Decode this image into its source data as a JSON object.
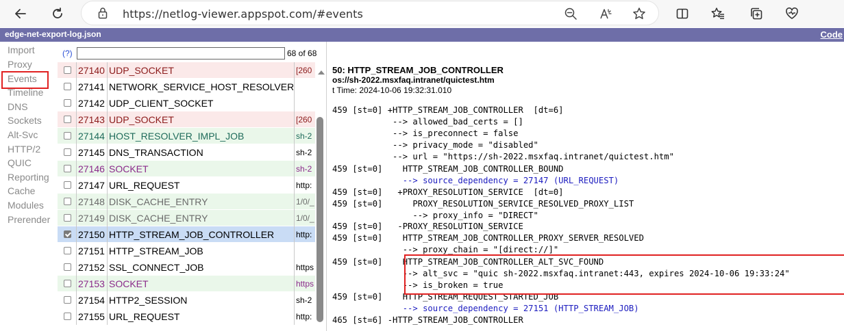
{
  "browser": {
    "url": "https://netlog-viewer.appspot.com/#events"
  },
  "app": {
    "title": "edge-net-export-log.json",
    "code_link": "Code"
  },
  "sidebar": {
    "items": [
      {
        "label": "Import"
      },
      {
        "label": "Proxy"
      },
      {
        "label": "Events"
      },
      {
        "label": "Timeline"
      },
      {
        "label": "DNS"
      },
      {
        "label": "Sockets"
      },
      {
        "label": "Alt-Svc"
      },
      {
        "label": "HTTP/2"
      },
      {
        "label": "QUIC"
      },
      {
        "label": "Reporting"
      },
      {
        "label": "Cache"
      },
      {
        "label": "Modules"
      },
      {
        "label": "Prerender"
      }
    ]
  },
  "events": {
    "help_link": "(?)",
    "filter_value": "",
    "count": "68 of 68",
    "rows": [
      {
        "id": "27140",
        "type": "UDP_SOCKET",
        "desc": "[260",
        "checked": false,
        "bg": "#fbe9e9",
        "color": "#8b1a1a"
      },
      {
        "id": "27141",
        "type": "NETWORK_SERVICE_HOST_RESOLVER",
        "desc": "",
        "checked": false,
        "bg": "#ffffff",
        "color": "#000000"
      },
      {
        "id": "27142",
        "type": "UDP_CLIENT_SOCKET",
        "desc": "",
        "checked": false,
        "bg": "#ffffff",
        "color": "#000000"
      },
      {
        "id": "27143",
        "type": "UDP_SOCKET",
        "desc": "[260",
        "checked": false,
        "bg": "#fbe9e9",
        "color": "#8b1a1a"
      },
      {
        "id": "27144",
        "type": "HOST_RESOLVER_IMPL_JOB",
        "desc": "sh-2",
        "checked": false,
        "bg": "#eaf7ea",
        "color": "#1e6b5a"
      },
      {
        "id": "27145",
        "type": "DNS_TRANSACTION",
        "desc": "sh-2",
        "checked": false,
        "bg": "#ffffff",
        "color": "#000000"
      },
      {
        "id": "27146",
        "type": "SOCKET",
        "desc": "sh-2",
        "checked": false,
        "bg": "#eaf7ea",
        "color": "#8a2a8a"
      },
      {
        "id": "27147",
        "type": "URL_REQUEST",
        "desc": "http:",
        "checked": false,
        "bg": "#ffffff",
        "color": "#000000"
      },
      {
        "id": "27148",
        "type": "DISK_CACHE_ENTRY",
        "desc": "1/0/_",
        "checked": false,
        "bg": "#eaf7ea",
        "color": "#6a6a6a"
      },
      {
        "id": "27149",
        "type": "DISK_CACHE_ENTRY",
        "desc": "1/0/_",
        "checked": false,
        "bg": "#eaf7ea",
        "color": "#6a6a6a"
      },
      {
        "id": "27150",
        "type": "HTTP_STREAM_JOB_CONTROLLER",
        "desc": "http:",
        "checked": true,
        "bg": "#c9dcf5",
        "color": "#000000"
      },
      {
        "id": "27151",
        "type": "HTTP_STREAM_JOB",
        "desc": "",
        "checked": false,
        "bg": "#ffffff",
        "color": "#000000"
      },
      {
        "id": "27152",
        "type": "SSL_CONNECT_JOB",
        "desc": "https",
        "checked": false,
        "bg": "#ffffff",
        "color": "#000000"
      },
      {
        "id": "27153",
        "type": "SOCKET",
        "desc": "https",
        "checked": false,
        "bg": "#eaf7ea",
        "color": "#8a2a8a"
      },
      {
        "id": "27154",
        "type": "HTTP2_SESSION",
        "desc": "sh-2",
        "checked": false,
        "bg": "#ffffff",
        "color": "#000000"
      },
      {
        "id": "27155",
        "type": "URL_REQUEST",
        "desc": "http:",
        "checked": false,
        "bg": "#ffffff",
        "color": "#000000"
      }
    ]
  },
  "details": {
    "header_title": "50: HTTP_STREAM_JOB_CONTROLLER",
    "header_url": "os://sh-2022.msxfaq.intranet/quictest.htm",
    "start_time": "t Time: 2024-10-06 19:32:31.010",
    "log_lines": [
      {
        "text": "459 [st=0] +HTTP_STREAM_JOB_CONTROLLER  [dt=6]",
        "blue": false
      },
      {
        "text": "            --> allowed_bad_certs = []",
        "blue": false
      },
      {
        "text": "            --> is_preconnect = false",
        "blue": false
      },
      {
        "text": "            --> privacy_mode = \"disabled\"",
        "blue": false
      },
      {
        "text": "            --> url = \"https://sh-2022.msxfaq.intranet/quictest.htm\"",
        "blue": false
      },
      {
        "text": "459 [st=0]    HTTP_STREAM_JOB_CONTROLLER_BOUND",
        "blue": false
      },
      {
        "text": "              --> source_dependency = 27147 (URL_REQUEST)",
        "blue": true
      },
      {
        "text": "459 [st=0]   +PROXY_RESOLUTION_SERVICE  [dt=0]",
        "blue": false
      },
      {
        "text": "459 [st=0]      PROXY_RESOLUTION_SERVICE_RESOLVED_PROXY_LIST",
        "blue": false
      },
      {
        "text": "                --> proxy_info = \"DIRECT\"",
        "blue": false
      },
      {
        "text": "459 [st=0]   -PROXY_RESOLUTION_SERVICE",
        "blue": false
      },
      {
        "text": "459 [st=0]    HTTP_STREAM_JOB_CONTROLLER_PROXY_SERVER_RESOLVED",
        "blue": false
      },
      {
        "text": "              --> proxy_chain = \"[direct://]\"",
        "blue": false
      },
      {
        "text": "459 [st=0]    HTTP_STREAM_JOB_CONTROLLER_ALT_SVC_FOUND",
        "blue": false
      },
      {
        "text": "              --> alt_svc = \"quic sh-2022.msxfaq.intranet:443, expires 2024-10-06 19:33:24\"",
        "blue": false
      },
      {
        "text": "              --> is_broken = true",
        "blue": false
      },
      {
        "text": "459 [st=0]    HTTP_STREAM_REQUEST_STARTED_JOB",
        "blue": false
      },
      {
        "text": "              --> source_dependency = 27151 (HTTP_STREAM_JOB)",
        "blue": true
      },
      {
        "text": "465 [st=6] -HTTP_STREAM_JOB_CONTROLLER",
        "blue": false
      }
    ]
  },
  "icons": {
    "back": "back-arrow-icon",
    "refresh": "refresh-icon",
    "lock": "lock-icon",
    "zoom": "zoom-icon",
    "read_aloud": "read-aloud-icon",
    "favorite": "star-icon",
    "split": "split-screen-icon",
    "favorites": "favorites-icon",
    "collections": "collections-icon",
    "health": "browser-essentials-icon"
  }
}
